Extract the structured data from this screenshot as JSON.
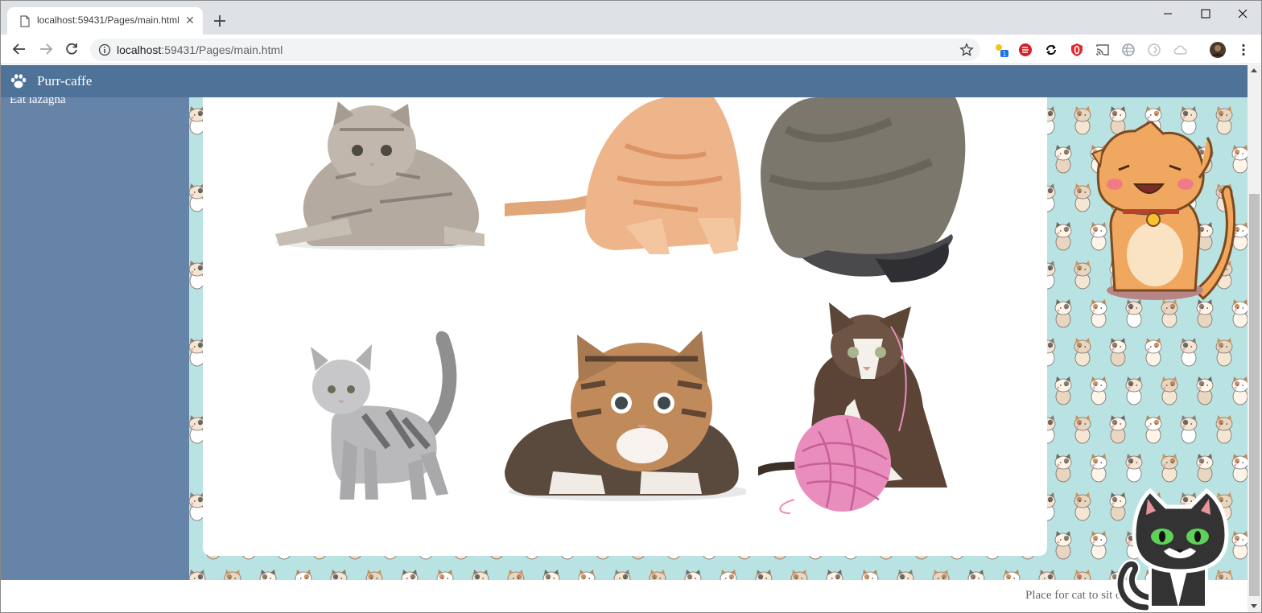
{
  "browser": {
    "tab_title": "localhost:59431/Pages/main.html",
    "url_host": "localhost",
    "url_rest": ":59431/Pages/main.html",
    "new_tab_icon": "plus-icon",
    "extension_badge": "1"
  },
  "site": {
    "brand": "Purr-caffe",
    "brand_icon": "paw-icon",
    "nav_color": "#4f7299",
    "sidebar_color": "#6684a8",
    "sidebar_items": [
      "Eat lazagna"
    ],
    "pattern_color": "#b8e3e2",
    "footer_text": "Place for cat to sit on"
  },
  "gallery": {
    "images": [
      "tabby-kitten-crouching",
      "orange-kitten-stretching",
      "grey-longhair-cat-sitting",
      "silver-tabby-kitten-standing",
      "brown-tabby-kitten-lying",
      "calico-kitten-with-pink-yarn"
    ]
  }
}
